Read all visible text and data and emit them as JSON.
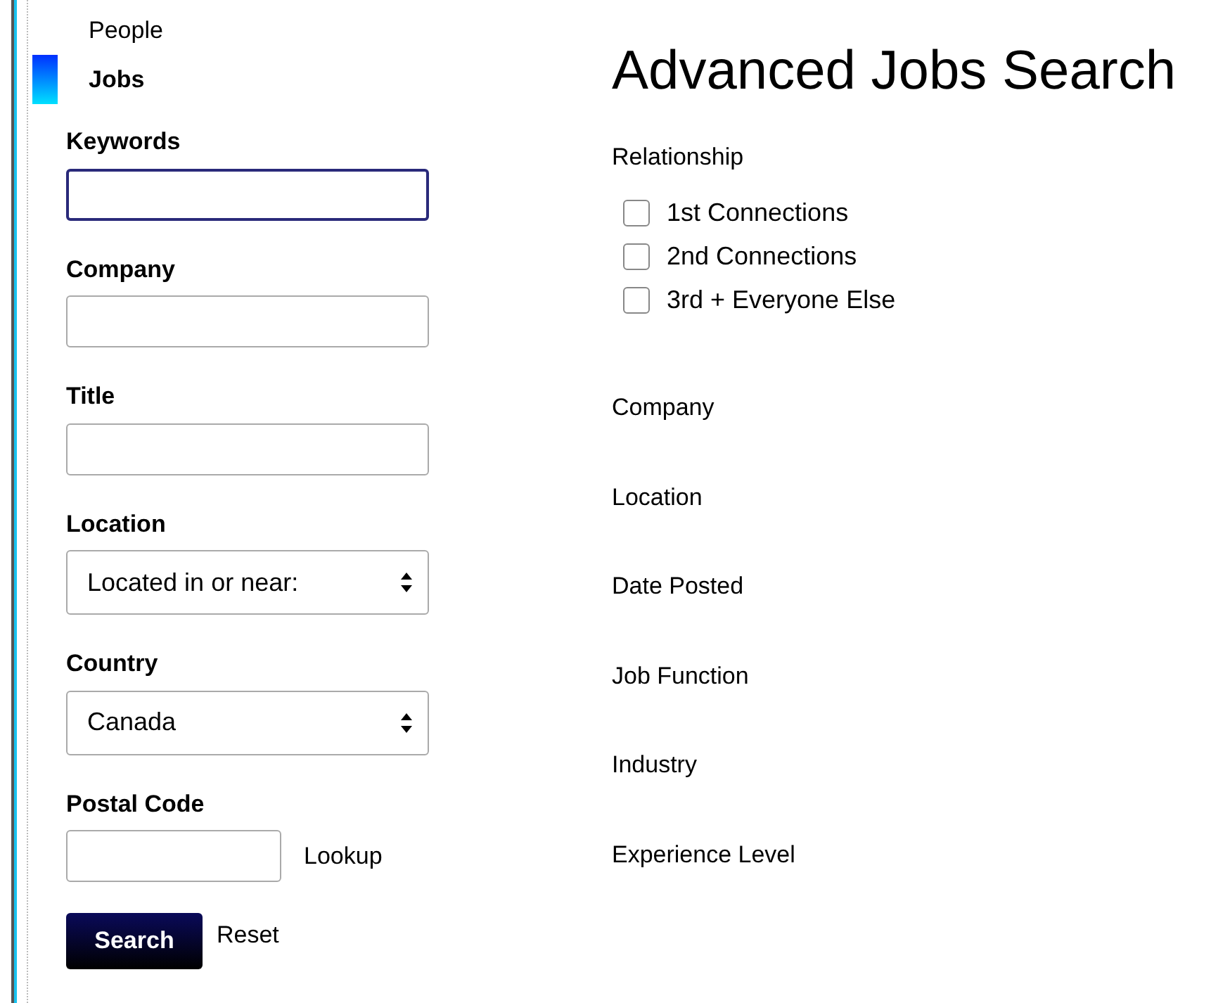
{
  "tabs": [
    {
      "label": "People",
      "selected": false
    },
    {
      "label": "Jobs",
      "selected": true
    }
  ],
  "fields": [
    {
      "kind": "text",
      "label": "Keywords",
      "focused": true
    },
    {
      "kind": "text",
      "label": "Company",
      "focused": false
    },
    {
      "kind": "text",
      "label": "Title",
      "focused": false
    },
    {
      "kind": "select",
      "label": "Location",
      "value": "Located in or near:"
    },
    {
      "kind": "select",
      "label": "Country",
      "value": "Canada"
    },
    {
      "kind": "lookup",
      "label": "Postal Code",
      "link": "Lookup"
    }
  ],
  "actions": {
    "search": "Search",
    "reset": "Reset"
  },
  "heading": "Advanced Jobs Search",
  "relationship": {
    "label": "Relationship",
    "options": [
      {
        "label": "1st Connections",
        "checked": false
      },
      {
        "label": "2nd Connections",
        "checked": false
      },
      {
        "label": "3rd + Everyone Else",
        "checked": false
      }
    ]
  },
  "facets": [
    "Company",
    "Location",
    "Date Posted",
    "Job Function",
    "Industry",
    "Experience Level"
  ]
}
